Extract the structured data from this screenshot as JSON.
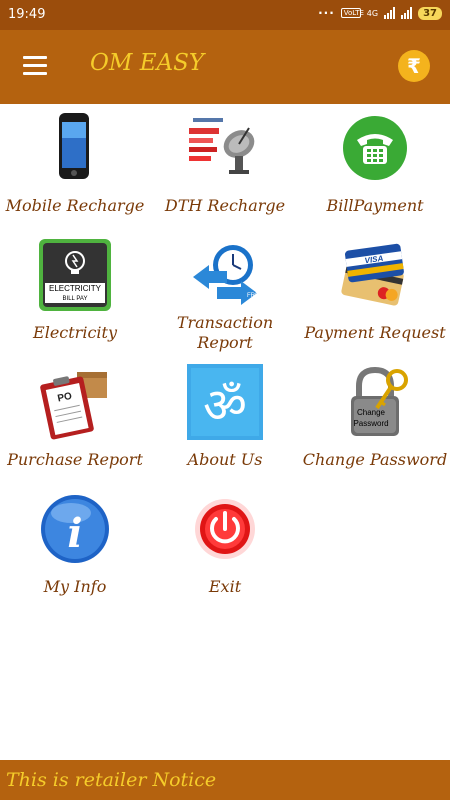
{
  "status_bar": {
    "time": "19:49",
    "network": "4G",
    "battery": "37"
  },
  "app_bar": {
    "title": "OM EASY",
    "wallet_symbol": "₹"
  },
  "menu": [
    {
      "label": "Mobile Recharge",
      "icon": "mobile-phone-icon"
    },
    {
      "label": "DTH Recharge",
      "icon": "satellite-dish-icon"
    },
    {
      "label": "BillPayment",
      "icon": "telephone-icon"
    },
    {
      "label": "Electricity",
      "icon": "electricity-bill-icon",
      "icon_text": "ELECTRICITY",
      "icon_subtext": "BILL PAY"
    },
    {
      "label": "Transaction Report",
      "line1": "Transaction",
      "line2": "Report",
      "icon": "transaction-clock-icon"
    },
    {
      "label": "Payment Request",
      "icon": "credit-cards-icon",
      "icon_text": "VISA"
    },
    {
      "label": "Purchase Report",
      "icon": "clipboard-po-icon",
      "icon_text": "PO"
    },
    {
      "label": "About Us",
      "icon": "om-symbol-icon",
      "icon_text": "ॐ"
    },
    {
      "label": "Change Password",
      "icon": "padlock-key-icon",
      "icon_text": "Change",
      "icon_subtext": "Password"
    },
    {
      "label": "My Info",
      "icon": "info-icon",
      "icon_text": "i"
    },
    {
      "label": "Exit",
      "icon": "power-icon"
    }
  ],
  "notice": "This is retailer Notice",
  "colors": {
    "status_bar": "#9b4d0c",
    "app_bar": "#b4620f",
    "title": "#f5cc2a",
    "label": "#7a3a08"
  }
}
